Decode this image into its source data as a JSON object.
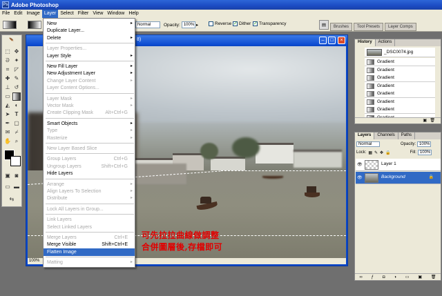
{
  "app": {
    "title": "Adobe Photoshop"
  },
  "menubar": [
    "File",
    "Edit",
    "Image",
    "Layer",
    "Select",
    "Filter",
    "View",
    "Window",
    "Help"
  ],
  "options": {
    "mode_value": "Normal",
    "opacity_label": "Opacity:",
    "opacity_value": "100%",
    "reverse_label": "Reverse",
    "dither_label": "Dither",
    "transparency_label": "Transparency"
  },
  "palette_well": [
    "Brushes",
    "Tool Presets",
    "Layer Comps"
  ],
  "document": {
    "title_suffix": "8)",
    "zoom": "100%"
  },
  "layer_menu": {
    "items": [
      {
        "label": "New",
        "arrow": true,
        "disabled": false
      },
      {
        "label": "Duplicate Layer...",
        "disabled": false
      },
      {
        "label": "Delete",
        "arrow": true,
        "disabled": false
      },
      {
        "sep": true
      },
      {
        "label": "Layer Properties...",
        "disabled": true
      },
      {
        "label": "Layer Style",
        "arrow": true,
        "disabled": false
      },
      {
        "sep": true
      },
      {
        "label": "New Fill Layer",
        "arrow": true,
        "disabled": false
      },
      {
        "label": "New Adjustment Layer",
        "arrow": true,
        "disabled": false
      },
      {
        "label": "Change Layer Content",
        "arrow": true,
        "disabled": true
      },
      {
        "label": "Layer Content Options...",
        "disabled": true
      },
      {
        "sep": true
      },
      {
        "label": "Layer Mask",
        "arrow": true,
        "disabled": true
      },
      {
        "label": "Vector Mask",
        "arrow": true,
        "disabled": true
      },
      {
        "label": "Create Clipping Mask",
        "shortcut": "Alt+Ctrl+G",
        "disabled": true
      },
      {
        "sep": true
      },
      {
        "label": "Smart Objects",
        "arrow": true,
        "disabled": false
      },
      {
        "label": "Type",
        "arrow": true,
        "disabled": true
      },
      {
        "label": "Rasterize",
        "arrow": true,
        "disabled": true
      },
      {
        "sep": true
      },
      {
        "label": "New Layer Based Slice",
        "disabled": true
      },
      {
        "sep": true
      },
      {
        "label": "Group Layers",
        "shortcut": "Ctrl+G",
        "disabled": true
      },
      {
        "label": "Ungroup Layers",
        "shortcut": "Shift+Ctrl+G",
        "disabled": true
      },
      {
        "label": "Hide Layers",
        "disabled": false
      },
      {
        "sep": true
      },
      {
        "label": "Arrange",
        "arrow": true,
        "disabled": true
      },
      {
        "label": "Align Layers To Selection",
        "arrow": true,
        "disabled": true
      },
      {
        "label": "Distribute",
        "arrow": true,
        "disabled": true
      },
      {
        "sep": true
      },
      {
        "label": "Lock All Layers in Group...",
        "disabled": true
      },
      {
        "sep": true
      },
      {
        "label": "Link Layers",
        "disabled": true
      },
      {
        "label": "Select Linked Layers",
        "disabled": true
      },
      {
        "sep": true
      },
      {
        "label": "Merge Layers",
        "shortcut": "Ctrl+E",
        "disabled": true
      },
      {
        "label": "Merge Visible",
        "shortcut": "Shift+Ctrl+E",
        "disabled": false
      },
      {
        "label": "Flatten Image",
        "disabled": false,
        "highlighted": true
      },
      {
        "sep": true
      },
      {
        "label": "Matting",
        "arrow": true,
        "disabled": true
      }
    ]
  },
  "caption": {
    "line1": "可先拉拉曲線做調整",
    "line2": "合併圖層後,存檔即可"
  },
  "history_panel": {
    "tabs": [
      "History",
      "Actions"
    ],
    "snapshot": "_DSC0074.jpg",
    "items": [
      "Gradient",
      "Gradient",
      "Gradient",
      "Gradient",
      "Gradient",
      "Gradient",
      "Gradient",
      "Gradient"
    ]
  },
  "layers_panel": {
    "tabs": [
      "Layers",
      "Channels",
      "Paths"
    ],
    "blend_mode": "Normal",
    "opacity_label": "Opacity:",
    "opacity_value": "100%",
    "lock_label": "Lock:",
    "fill_label": "Fill:",
    "fill_value": "100%",
    "layers": [
      {
        "name": "Layer 1",
        "selected": false
      },
      {
        "name": "Background",
        "selected": true
      }
    ]
  }
}
